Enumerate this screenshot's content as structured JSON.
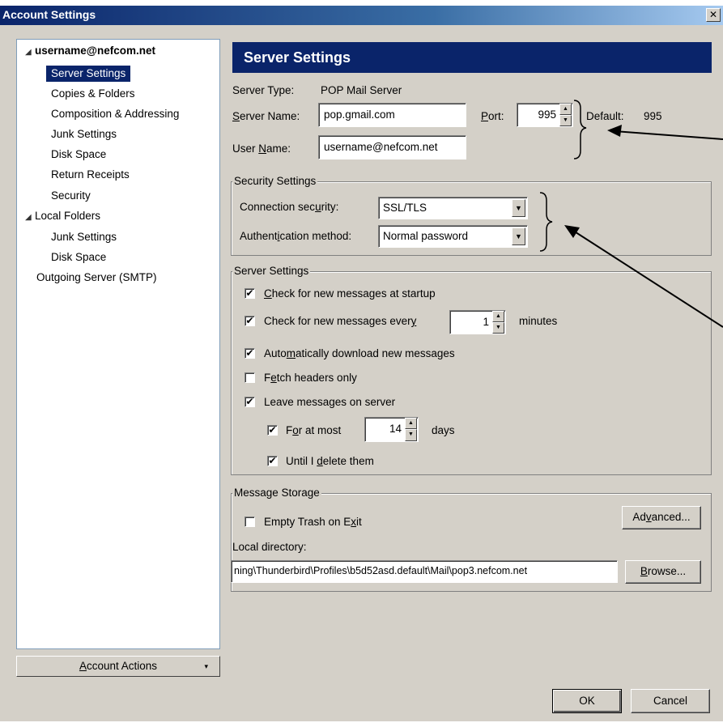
{
  "window": {
    "title": "Account Settings",
    "close_glyph": "✕"
  },
  "tree": {
    "items": [
      {
        "label": "username@nefcom.net",
        "level": 0,
        "bold": true,
        "expanded": true
      },
      {
        "label": "Server Settings",
        "level": 1,
        "selected": true
      },
      {
        "label": "Copies & Folders",
        "level": 1
      },
      {
        "label": "Composition & Addressing",
        "level": 1
      },
      {
        "label": "Junk Settings",
        "level": 1
      },
      {
        "label": "Disk Space",
        "level": 1
      },
      {
        "label": "Return Receipts",
        "level": 1
      },
      {
        "label": "Security",
        "level": 1
      },
      {
        "label": "Local Folders",
        "level": 0,
        "expanded": true
      },
      {
        "label": "Junk Settings",
        "level": 1
      },
      {
        "label": "Disk Space",
        "level": 1
      },
      {
        "label": "Outgoing Server (SMTP)",
        "level": 0
      }
    ],
    "account_actions_label": "Account Actions"
  },
  "server": {
    "heading": "Server Settings",
    "type_label": "Server Type:",
    "type_value": "POP Mail Server",
    "name_label": "Server Name:",
    "name_value": "pop.gmail.com",
    "port_label": "Port:",
    "port_value": "995",
    "default_label": "Default:",
    "default_value": "995",
    "user_label": "User Name:",
    "user_value": "username@nefcom.net"
  },
  "security": {
    "title": "Security Settings",
    "connection_label": "Connection security:",
    "connection_value": "SSL/TLS",
    "auth_label": "Authentication method:",
    "auth_value": "Normal password"
  },
  "server_settings_group": {
    "title": "Server Settings",
    "check_startup": {
      "label": "Check for new messages at startup",
      "checked": true
    },
    "check_every": {
      "label": "Check for new messages every",
      "checked": true,
      "value": "1",
      "unit": "minutes"
    },
    "auto_download": {
      "label": "Automatically download new messages",
      "checked": true
    },
    "headers_only": {
      "label": "Fetch headers only",
      "checked": false
    },
    "leave_on_server": {
      "label": "Leave messages on server",
      "checked": true
    },
    "for_at_most": {
      "label": "For at most",
      "checked": true,
      "value": "14",
      "unit": "days"
    },
    "until_delete": {
      "label": "Until I delete them",
      "checked": true
    }
  },
  "storage": {
    "title": "Message Storage",
    "empty_trash": {
      "label": "Empty Trash on Exit",
      "checked": false
    },
    "advanced_label": "Advanced...",
    "local_dir_label": "Local directory:",
    "local_dir_value": "ning\\Thunderbird\\Profiles\\b5d52asd.default\\Mail\\pop3.nefcom.net",
    "browse_label": "Browse..."
  },
  "footer": {
    "ok_label": "OK",
    "cancel_label": "Cancel"
  },
  "glyphs": {
    "check": "✔",
    "dropdown": "▼",
    "spin_up": "▲",
    "spin_down": "▼",
    "twisty": "◢",
    "actions_arrow": "▾"
  }
}
